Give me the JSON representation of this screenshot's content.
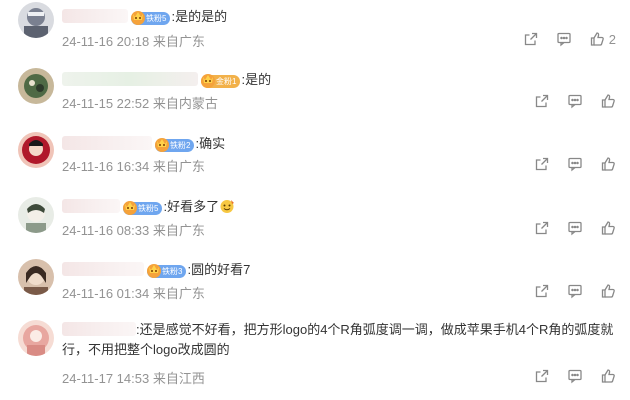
{
  "replies": [
    {
      "badge": "铁粉5",
      "badge_color": "#6fa6ef",
      "text": ":是的是的",
      "time": "24-11-16 20:18",
      "location": "来自广东",
      "like_count": "2",
      "avatar_colors": [
        "#7a8090",
        "#d9dbe0"
      ]
    },
    {
      "badge": "金粉1",
      "badge_color": "#f2b14a",
      "text": ":是的",
      "time": "24-11-15 22:52",
      "location": "来自内蒙古",
      "avatar_colors": [
        "#4f6a45",
        "#c7b89a"
      ]
    },
    {
      "badge": "铁粉2",
      "badge_color": "#6fa6ef",
      "text": ":确实",
      "time": "24-11-16 16:34",
      "location": "来自广东",
      "avatar_colors": [
        "#b0182a",
        "#f0c4b8"
      ]
    },
    {
      "badge": "铁粉5",
      "badge_color": "#6fa6ef",
      "text": ":好看多了",
      "time": "24-11-16 08:33",
      "location": "来自广东",
      "avatar_colors": [
        "#8c9a8a",
        "#e8ece6"
      ]
    },
    {
      "badge": "铁粉3",
      "badge_color": "#6fa6ef",
      "text": ":圆的好看7",
      "time": "24-11-16 01:34",
      "location": "来自广东",
      "avatar_colors": [
        "#7a5a48",
        "#d8c0ac"
      ]
    },
    {
      "text": ":还是感觉不好看，把方形logo的4个R角弧度调一调，做成苹果手机4个R角的弧度就行，不用把整个logo改成圆的",
      "time": "24-11-17 14:53",
      "location": "来自江西",
      "avatar_colors": [
        "#e8a7a0",
        "#f6dcd4"
      ]
    }
  ]
}
